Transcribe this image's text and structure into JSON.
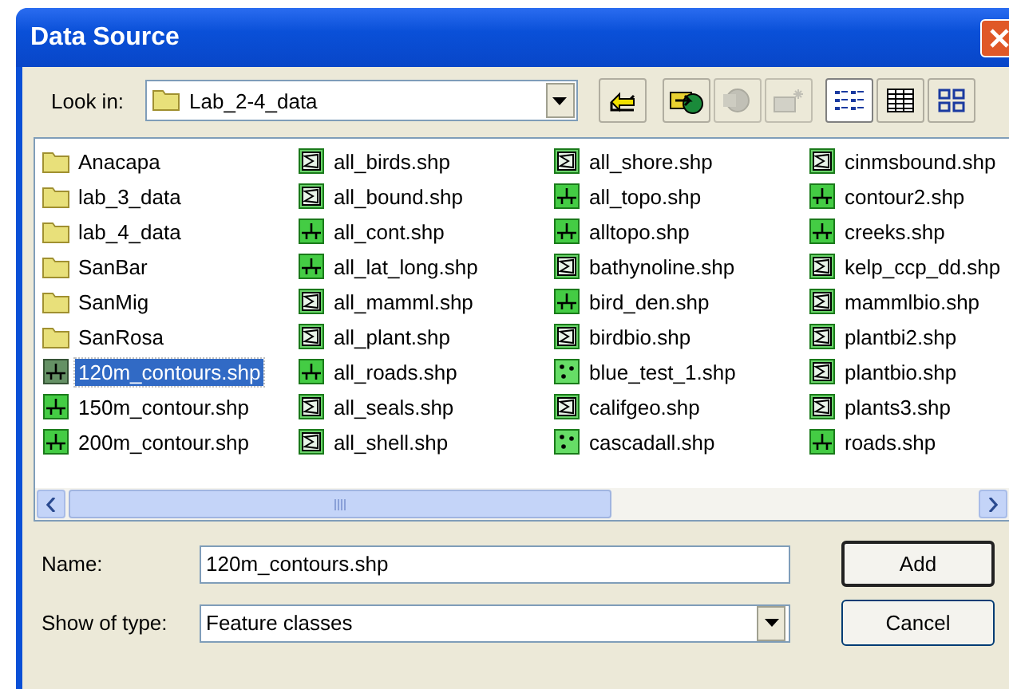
{
  "window": {
    "title": "Data Source"
  },
  "look_in": {
    "label": "Look in:",
    "value": "Lab_2-4_data"
  },
  "toolbar": [
    {
      "kind": "up",
      "disabled": false
    },
    {
      "kind": "connect",
      "disabled": false
    },
    {
      "kind": "disconnect",
      "disabled": true
    },
    {
      "kind": "new",
      "disabled": true
    }
  ],
  "views": [
    {
      "kind": "list",
      "selected": true
    },
    {
      "kind": "details",
      "selected": false
    },
    {
      "kind": "thumbnails",
      "selected": false
    }
  ],
  "files": [
    {
      "name": "Anacapa",
      "kind": "folder",
      "selected": false
    },
    {
      "name": "lab_3_data",
      "kind": "folder",
      "selected": false
    },
    {
      "name": "lab_4_data",
      "kind": "folder",
      "selected": false
    },
    {
      "name": "SanBar",
      "kind": "folder",
      "selected": false
    },
    {
      "name": "SanMig",
      "kind": "folder",
      "selected": false
    },
    {
      "name": "SanRosa",
      "kind": "folder",
      "selected": false
    },
    {
      "name": "120m_contours.shp",
      "kind": "line",
      "selected": true
    },
    {
      "name": "150m_contour.shp",
      "kind": "line",
      "selected": false
    },
    {
      "name": "200m_contour.shp",
      "kind": "line",
      "selected": false
    },
    {
      "name": "all_birds.shp",
      "kind": "polygon",
      "selected": false
    },
    {
      "name": "all_bound.shp",
      "kind": "polygon",
      "selected": false
    },
    {
      "name": "all_cont.shp",
      "kind": "line",
      "selected": false
    },
    {
      "name": "all_lat_long.shp",
      "kind": "line",
      "selected": false
    },
    {
      "name": "all_mamml.shp",
      "kind": "polygon",
      "selected": false
    },
    {
      "name": "all_plant.shp",
      "kind": "polygon",
      "selected": false
    },
    {
      "name": "all_roads.shp",
      "kind": "line",
      "selected": false
    },
    {
      "name": "all_seals.shp",
      "kind": "polygon",
      "selected": false
    },
    {
      "name": "all_shell.shp",
      "kind": "polygon",
      "selected": false
    },
    {
      "name": "all_shore.shp",
      "kind": "polygon",
      "selected": false
    },
    {
      "name": "all_topo.shp",
      "kind": "line",
      "selected": false
    },
    {
      "name": "alltopo.shp",
      "kind": "line",
      "selected": false
    },
    {
      "name": "bathynoline.shp",
      "kind": "polygon",
      "selected": false
    },
    {
      "name": "bird_den.shp",
      "kind": "line",
      "selected": false
    },
    {
      "name": "birdbio.shp",
      "kind": "polygon",
      "selected": false
    },
    {
      "name": "blue_test_1.shp",
      "kind": "point",
      "selected": false
    },
    {
      "name": "califgeo.shp",
      "kind": "polygon",
      "selected": false
    },
    {
      "name": "cascadall.shp",
      "kind": "point",
      "selected": false
    },
    {
      "name": "cinmsbound.shp",
      "kind": "polygon",
      "selected": false
    },
    {
      "name": "contour2.shp",
      "kind": "line",
      "selected": false
    },
    {
      "name": "creeks.shp",
      "kind": "line",
      "selected": false
    },
    {
      "name": "kelp_ccp_dd.shp",
      "kind": "polygon",
      "selected": false
    },
    {
      "name": "mammlbio.shp",
      "kind": "polygon",
      "selected": false
    },
    {
      "name": "plantbi2.shp",
      "kind": "polygon",
      "selected": false
    },
    {
      "name": "plantbio.shp",
      "kind": "polygon",
      "selected": false
    },
    {
      "name": "plants3.shp",
      "kind": "polygon",
      "selected": false
    },
    {
      "name": "roads.shp",
      "kind": "line",
      "selected": false
    }
  ],
  "name_field": {
    "label": "Name:",
    "value": "120m_contours.shp"
  },
  "type_field": {
    "label": "Show of type:",
    "value": "Feature classes"
  },
  "buttons": [
    "Add",
    "Cancel"
  ]
}
